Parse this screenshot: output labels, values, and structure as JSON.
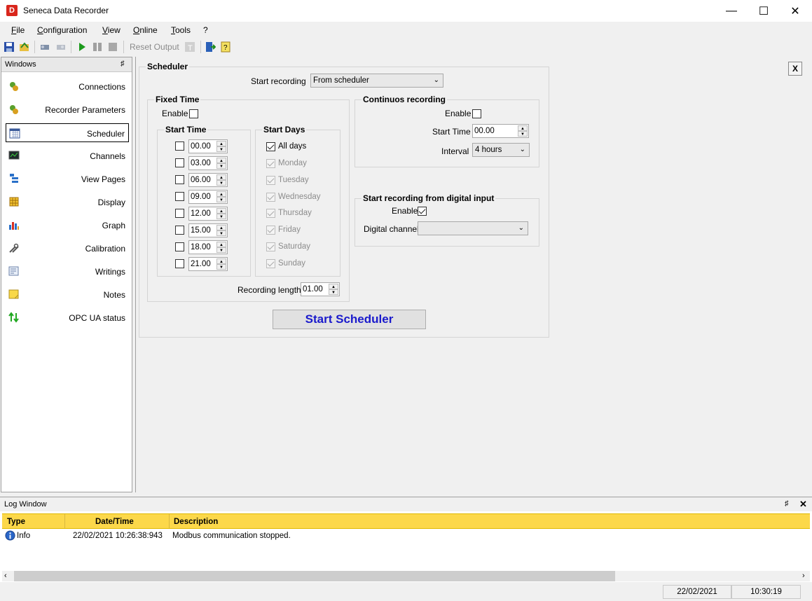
{
  "window": {
    "title": "Seneca Data Recorder",
    "app_icon_letter": "D"
  },
  "menu": [
    "File",
    "Configuration",
    "View",
    "Online",
    "Tools",
    "?"
  ],
  "toolbar": {
    "reset_output": "Reset Output"
  },
  "sidebar": {
    "title": "Windows",
    "items": [
      {
        "label": "Connections",
        "icon": "connections-icon"
      },
      {
        "label": "Recorder Parameters",
        "icon": "gears-icon"
      },
      {
        "label": "Scheduler",
        "icon": "calendar-icon"
      },
      {
        "label": "Channels",
        "icon": "monitor-icon"
      },
      {
        "label": "View Pages",
        "icon": "pages-icon"
      },
      {
        "label": "Display",
        "icon": "grid-icon"
      },
      {
        "label": "Graph",
        "icon": "bar-chart-icon"
      },
      {
        "label": "Calibration",
        "icon": "tools-icon"
      },
      {
        "label": "Writings",
        "icon": "edit-icon"
      },
      {
        "label": "Notes",
        "icon": "note-icon"
      },
      {
        "label": "OPC UA status",
        "icon": "arrows-icon"
      }
    ]
  },
  "scheduler": {
    "title": "Scheduler",
    "start_recording_label": "Start recording",
    "start_recording_value": "From scheduler",
    "fixed_time": {
      "title": "Fixed Time",
      "enable_label": "Enable",
      "start_time_title": "Start Time",
      "times": [
        "00.00",
        "03.00",
        "06.00",
        "09.00",
        "12.00",
        "15.00",
        "18.00",
        "21.00"
      ],
      "start_days_title": "Start Days",
      "days": [
        "All days",
        "Monday",
        "Tuesday",
        "Wednesday",
        "Thursday",
        "Friday",
        "Saturday",
        "Sunday"
      ],
      "recording_length_label": "Recording length",
      "recording_length_value": "01.00"
    },
    "continuous": {
      "title": "Continuos recording",
      "enable_label": "Enable",
      "start_time_label": "Start Time",
      "start_time_value": "00.00",
      "interval_label": "Interval",
      "interval_value": "4 hours"
    },
    "digital": {
      "title": "Start recording from digital input",
      "enable_label": "Enable",
      "channel_label": "Digital channel",
      "channel_value": ""
    },
    "start_button": "Start Scheduler",
    "close_label": "X"
  },
  "log": {
    "title": "Log Window",
    "columns": [
      "Type",
      "Date/Time",
      "Description"
    ],
    "rows": [
      {
        "type": "Info",
        "datetime": "22/02/2021 10:26:38:943",
        "description": "Modbus communication stopped."
      }
    ]
  },
  "status": {
    "date": "22/02/2021",
    "time": "10:30:19"
  }
}
